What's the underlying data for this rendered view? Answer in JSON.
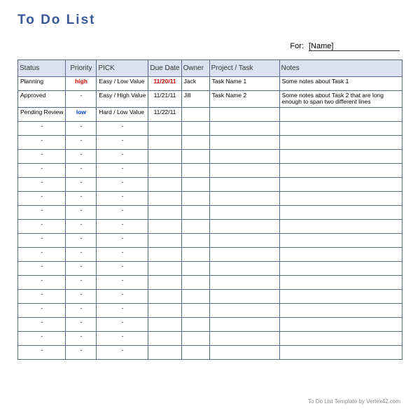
{
  "title": "To Do List",
  "for_label": "For:",
  "for_value": "[Name]",
  "columns": [
    "Status",
    "Priority",
    "PICK",
    "Due Date",
    "Owner",
    "Project / Task",
    "Notes"
  ],
  "rows": [
    {
      "status": "Planning",
      "priority": "high",
      "priority_class": "priority-high",
      "pick": "Easy / Low Value",
      "due": "11/20/11",
      "due_class": "due-highlight",
      "owner": "Jack",
      "project": "Task Name 1",
      "notes": "Some notes about Task 1"
    },
    {
      "status": "Approved",
      "priority": "-",
      "priority_class": "",
      "pick": "Easy / High Value",
      "due": "11/21/11",
      "due_class": "",
      "owner": "Jill",
      "project": "Task Name 2",
      "notes": "Some notes about Task 2 that are long enough to span two different lines"
    },
    {
      "status": "Pending Review",
      "priority": "low",
      "priority_class": "priority-low",
      "pick": "Hard / Low Value",
      "due": "11/22/11",
      "due_class": "",
      "owner": "",
      "project": "",
      "notes": ""
    },
    {
      "status": "-",
      "priority": "-",
      "priority_class": "",
      "pick": "-",
      "due": "",
      "due_class": "",
      "owner": "",
      "project": "",
      "notes": ""
    },
    {
      "status": "-",
      "priority": "-",
      "priority_class": "",
      "pick": "-",
      "due": "",
      "due_class": "",
      "owner": "",
      "project": "",
      "notes": ""
    },
    {
      "status": "-",
      "priority": "-",
      "priority_class": "",
      "pick": "-",
      "due": "",
      "due_class": "",
      "owner": "",
      "project": "",
      "notes": ""
    },
    {
      "status": "-",
      "priority": "-",
      "priority_class": "",
      "pick": "-",
      "due": "",
      "due_class": "",
      "owner": "",
      "project": "",
      "notes": ""
    },
    {
      "status": "-",
      "priority": "-",
      "priority_class": "",
      "pick": "-",
      "due": "",
      "due_class": "",
      "owner": "",
      "project": "",
      "notes": ""
    },
    {
      "status": "-",
      "priority": "-",
      "priority_class": "",
      "pick": "-",
      "due": "",
      "due_class": "",
      "owner": "",
      "project": "",
      "notes": ""
    },
    {
      "status": "-",
      "priority": "-",
      "priority_class": "",
      "pick": "-",
      "due": "",
      "due_class": "",
      "owner": "",
      "project": "",
      "notes": ""
    },
    {
      "status": "-",
      "priority": "-",
      "priority_class": "",
      "pick": "-",
      "due": "",
      "due_class": "",
      "owner": "",
      "project": "",
      "notes": ""
    },
    {
      "status": "-",
      "priority": "-",
      "priority_class": "",
      "pick": "-",
      "due": "",
      "due_class": "",
      "owner": "",
      "project": "",
      "notes": ""
    },
    {
      "status": "-",
      "priority": "-",
      "priority_class": "",
      "pick": "-",
      "due": "",
      "due_class": "",
      "owner": "",
      "project": "",
      "notes": ""
    },
    {
      "status": "-",
      "priority": "-",
      "priority_class": "",
      "pick": "-",
      "due": "",
      "due_class": "",
      "owner": "",
      "project": "",
      "notes": ""
    },
    {
      "status": "-",
      "priority": "-",
      "priority_class": "",
      "pick": "-",
      "due": "",
      "due_class": "",
      "owner": "",
      "project": "",
      "notes": ""
    },
    {
      "status": "-",
      "priority": "-",
      "priority_class": "",
      "pick": "-",
      "due": "",
      "due_class": "",
      "owner": "",
      "project": "",
      "notes": ""
    },
    {
      "status": "-",
      "priority": "-",
      "priority_class": "",
      "pick": "-",
      "due": "",
      "due_class": "",
      "owner": "",
      "project": "",
      "notes": ""
    },
    {
      "status": "-",
      "priority": "-",
      "priority_class": "",
      "pick": "-",
      "due": "",
      "due_class": "",
      "owner": "",
      "project": "",
      "notes": ""
    },
    {
      "status": "-",
      "priority": "-",
      "priority_class": "",
      "pick": "-",
      "due": "",
      "due_class": "",
      "owner": "",
      "project": "",
      "notes": ""
    },
    {
      "status": "-",
      "priority": "-",
      "priority_class": "",
      "pick": "-",
      "due": "",
      "due_class": "",
      "owner": "",
      "project": "",
      "notes": ""
    }
  ],
  "footer": "To Do List Template by Vertex42.com"
}
